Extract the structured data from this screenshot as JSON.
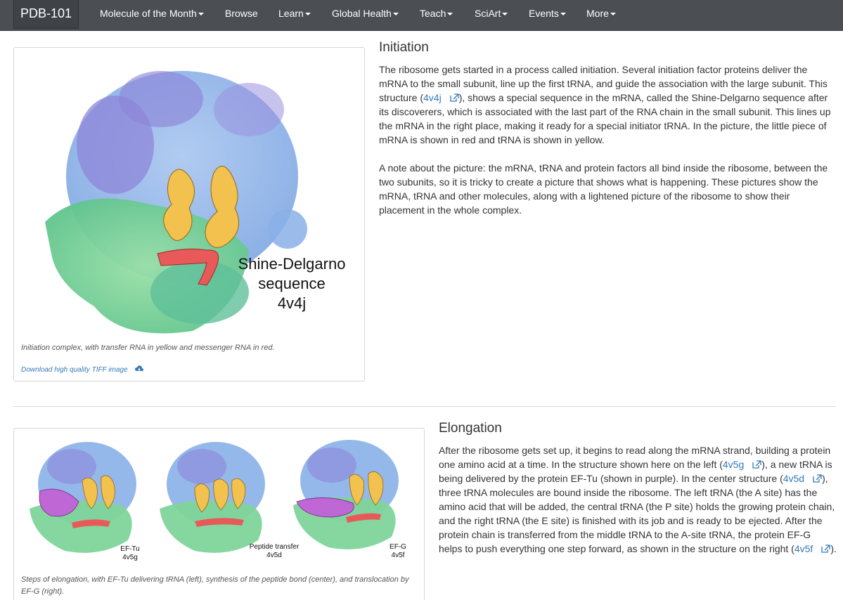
{
  "navbar": {
    "brand": "PDB-101",
    "items": [
      {
        "label": "Molecule of the Month",
        "dropdown": true
      },
      {
        "label": "Browse",
        "dropdown": false
      },
      {
        "label": "Learn",
        "dropdown": true
      },
      {
        "label": "Global Health",
        "dropdown": true
      },
      {
        "label": "Teach",
        "dropdown": true
      },
      {
        "label": "SciArt",
        "dropdown": true
      },
      {
        "label": "Events",
        "dropdown": true
      },
      {
        "label": "More",
        "dropdown": true
      }
    ]
  },
  "initiation": {
    "title": "Initiation",
    "figure": {
      "label_lines": [
        "Shine-Delgarno",
        "sequence",
        "4v4j"
      ],
      "caption": "Initiation complex, with transfer RNA in yellow and messenger RNA in red.",
      "download": "Download high quality TIFF image",
      "download_icon": "cloud-download-icon"
    },
    "p1": {
      "a": "The ribosome gets started in a process called initiation. Several initiation factor proteins deliver the mRNA to the small subunit, line up the first tRNA, and guide the association with the large subunit. This structure (",
      "link": "4v4j",
      "b": "), shows a special sequence in the mRNA, called the Shine-Delgarno sequence after its discoverers, which is associated with the last part of the RNA chain in the small subunit. This lines up the mRNA in the right place, making it ready for a special initiator tRNA. In the picture, the little piece of mRNA is shown in red and tRNA is shown in yellow."
    },
    "p2": "A note about the picture: the mRNA, tRNA and protein factors all bind inside the ribosome, between the two subunits, so it is tricky to create a picture that shows what is happening. These pictures show the mRNA, tRNA and other molecules, along with a lightened picture of the ribosome to show their placement in the whole complex."
  },
  "elongation": {
    "title": "Elongation",
    "figure": {
      "panels": [
        {
          "label_lines": [
            "EF-Tu",
            "4v5g"
          ]
        },
        {
          "label_lines": [
            "Peptide transfer",
            "4v5d"
          ]
        },
        {
          "label_lines": [
            "EF-G",
            "4v5f"
          ]
        }
      ],
      "caption": "Steps of elongation, with EF-Tu delivering tRNA (left), synthesis of the peptide bond (center), and translocation by EF-G (right)."
    },
    "p1": {
      "a": "After the ribosome gets set up, it begins to read along the mRNA strand, building a protein one amino acid at a time. In the structure shown here on the left (",
      "link1": "4v5g",
      "b": "), a new tRNA is being delivered by the protein EF-Tu (shown in purple). In the center structure (",
      "link2": "4v5d",
      "c": "), three tRNA molecules are bound inside the ribosome. The left tRNA (the A site) has the amino acid that will be added, the central tRNA (the P site) holds the growing protein chain, and the right tRNA (the E site) is finished with its job and is ready to be ejected. After the protein chain is transferred from the middle tRNA to the A-site tRNA, the protein EF-G helps to push everything one step forward, as shown in the structure on the right (",
      "link3": "4v5f",
      "d": ")."
    }
  },
  "colors": {
    "navbar": "#4b4f54",
    "link": "#337ab7",
    "ribosome_large": "#8ab0e8",
    "ribosome_purple": "#8d86d8",
    "ribosome_small": "#7fd49a",
    "trna": "#f2c14e",
    "mrna": "#e85a5a",
    "ef_protein": "#c067d6"
  }
}
